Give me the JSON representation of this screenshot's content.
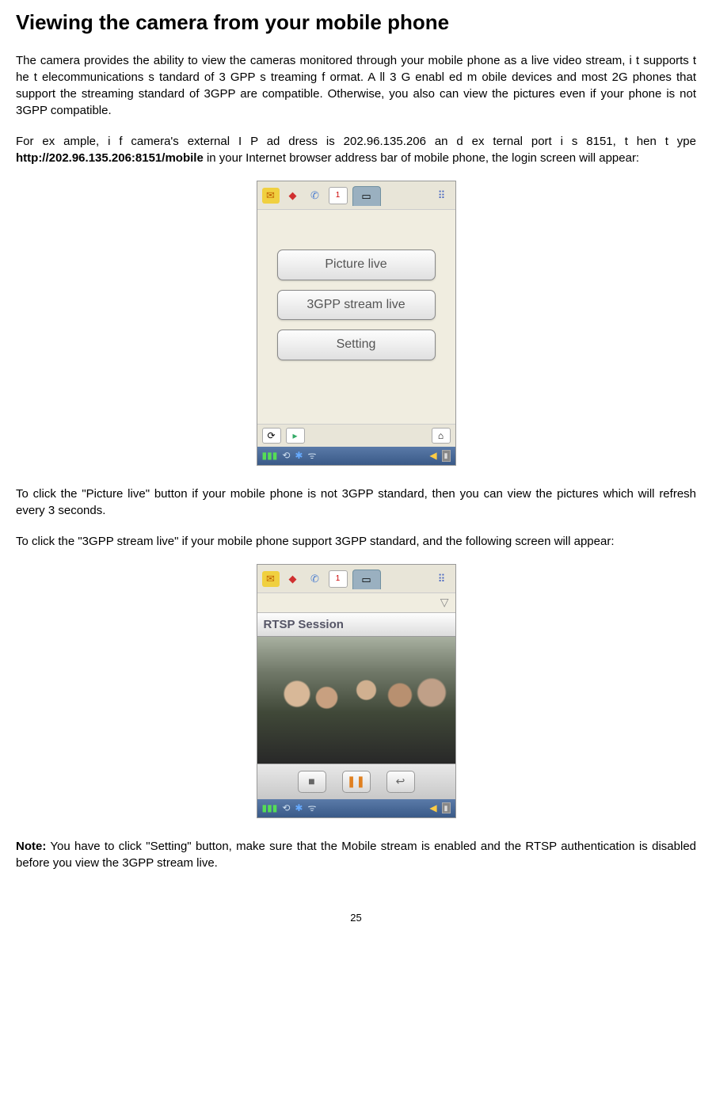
{
  "title": "Viewing the camera from your mobile phone",
  "para1": "The camera provides the ability to view the cameras monitored through your mobile phone as a live video stream, i t supports t he t elecommunications s tandard of 3 GPP s treaming f ormat. A ll 3 G enabl ed m obile devices and most 2G phones that support the streaming standard of 3GPP are compatible. Otherwise, you also can view the pictures even if your phone is not 3GPP compatible.",
  "para2a": "For ex ample, i f  camera's  external I P ad dress  is  202.96.135.206 an d ex ternal  port i s  8151, t hen t ype ",
  "para2b": "http://202.96.135.206:8151/mobile",
  "para2c": " in your Internet browser address bar of mobile phone, the login screen will appear:",
  "fig1": {
    "btn1": "Picture live",
    "btn2": "3GPP stream live",
    "btn3": "Setting",
    "cal": "1"
  },
  "para3": "To click the \"Picture live\" button if your mobile phone is not 3GPP standard, then you can view the pictures which will refresh every 3 seconds.",
  "para4": "To click the \"3GPP stream live\" if your mobile phone support 3GPP standard, and the following screen will appear:",
  "fig2": {
    "session": "RTSP Session",
    "cal": "1"
  },
  "note_label": "Note:",
  "note_text": " You have to click \"Setting\" button, make sure that the Mobile stream is enabled and the RTSP authentication is disabled before you view the 3GPP stream live.",
  "page_number": "25"
}
